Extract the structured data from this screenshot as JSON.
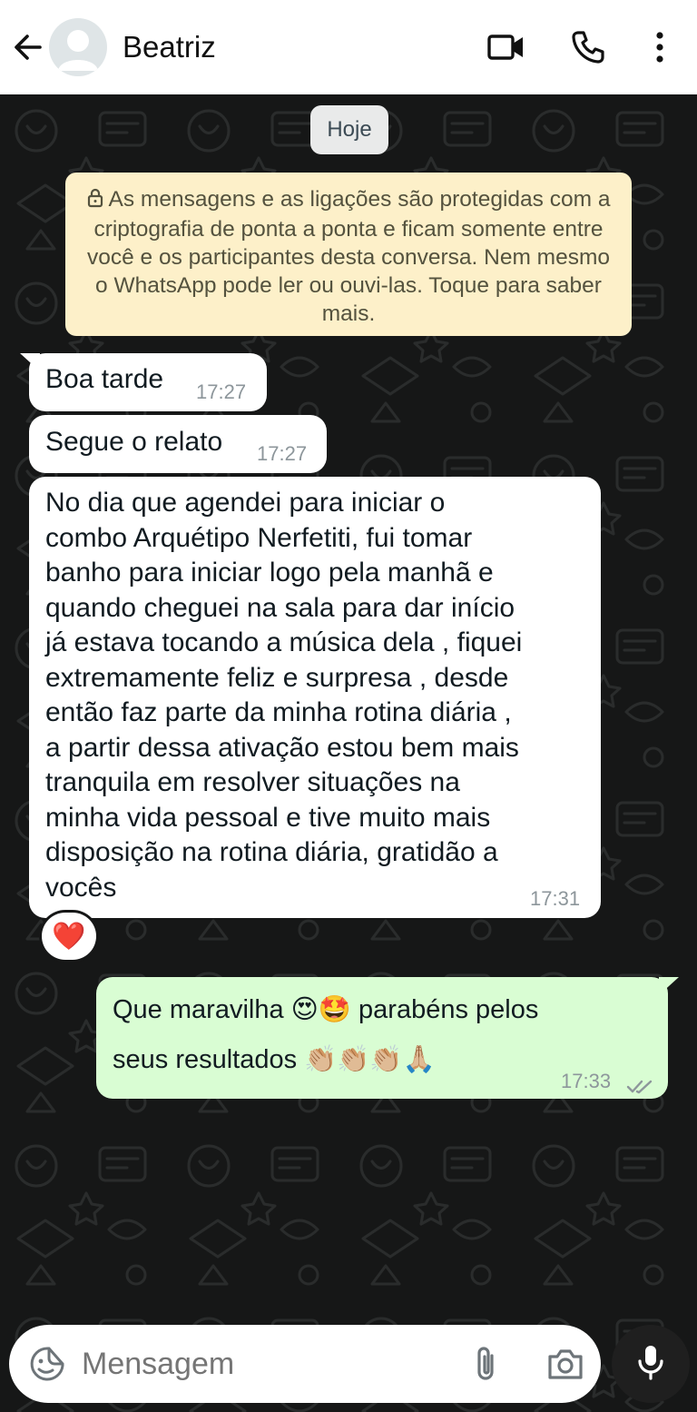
{
  "header": {
    "contact_name": "Beatriz",
    "icons": [
      "back-arrow-icon",
      "avatar",
      "video-call-icon",
      "phone-call-icon",
      "more-options-icon"
    ]
  },
  "chat": {
    "date_chip": "Hoje",
    "encryption_notice": "As mensagens e as ligações são protegidas com a criptografia de ponta a ponta e ficam somente entre você e os participantes desta conversa. Nem mesmo o WhatsApp pode ler ou ouvi-las. Toque para saber mais.",
    "messages": [
      {
        "direction": "in",
        "text": "Boa tarde",
        "time": "17:27"
      },
      {
        "direction": "in",
        "text": "Segue o relato",
        "time": "17:27"
      },
      {
        "direction": "in",
        "text": "No dia que agendei para iniciar o\ncombo Arquétipo Nerfetiti, fui tomar\nbanho para iniciar logo pela manhã e\nquando cheguei na sala para dar início\njá estava tocando a música dela , fiquei\nextremamente feliz e surpresa , desde\nentão faz parte da minha rotina diária ,\na partir dessa ativação estou bem mais\ntranquila em resolver situações na\nminha vida pessoal e tive muito mais\ndisposição na rotina diária, gratidão a\nvocês",
        "time": "17:31",
        "reaction": "❤️"
      },
      {
        "direction": "out",
        "text_line1": "Que maravilha 😍🤩 parabéns pelos",
        "text_line2": "seus resultados 👏🏼👏🏼👏🏼🙏🏼",
        "time": "17:33",
        "status": "read"
      }
    ]
  },
  "input": {
    "placeholder": "Mensagem",
    "icons": [
      "sticker-icon",
      "attach-icon",
      "camera-icon",
      "mic-icon"
    ]
  },
  "colors": {
    "chat_background": "#161717",
    "incoming_bubble": "#ffffff",
    "outgoing_bubble": "#d9fdd3",
    "notice_background": "#fdf0c9",
    "read_ticks": "#8d969b"
  }
}
